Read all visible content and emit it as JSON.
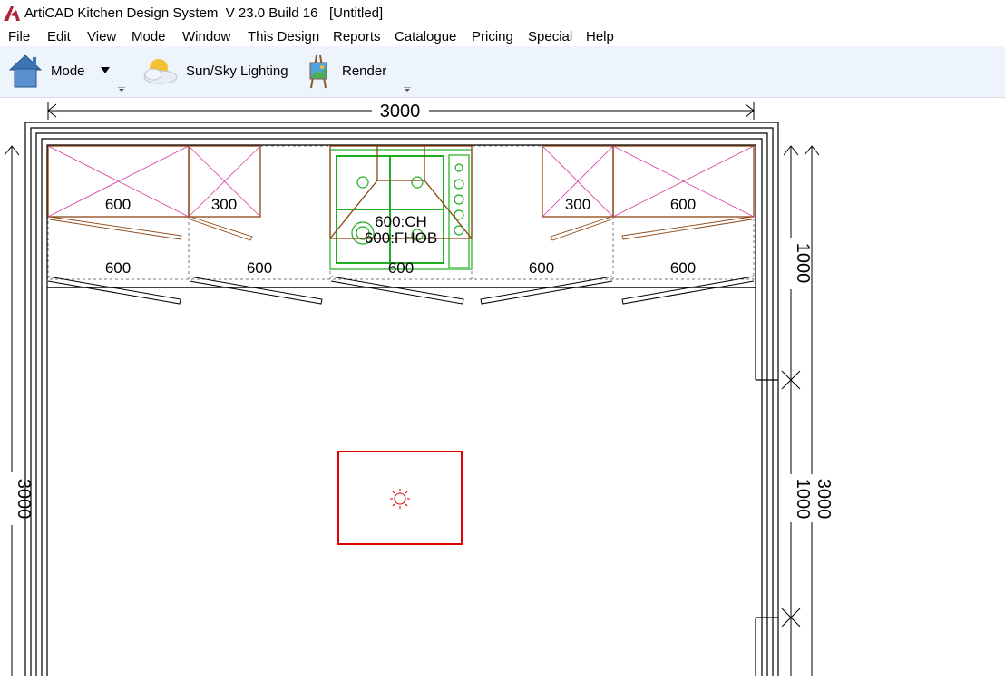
{
  "window": {
    "title": "ArtiCAD Kitchen Design System  V 23.0 Build 16   [Untitled]",
    "accent_color": "#b0223a"
  },
  "menu": {
    "items": [
      "File",
      "Edit",
      "View",
      "Mode",
      "Window",
      "This Design",
      "Reports",
      "Catalogue",
      "Pricing",
      "Special",
      "Help"
    ]
  },
  "toolbar": {
    "mode_label": "Mode",
    "mode_icon": "house-icon",
    "sun_label": "Sun/Sky Lighting",
    "sun_icon": "sun-cloud-icon",
    "render_label": "Render",
    "render_icon": "paint-easel-icon"
  },
  "plan": {
    "width_dim": "3000",
    "left_height_dim": "3000",
    "right_height_dim": "3000",
    "right_segment_top": "1000",
    "right_segment_mid": "1000",
    "wall_units": [
      "600",
      "300",
      "300",
      "600"
    ],
    "extractor_label": "600:CH",
    "hob_label": "600:FHOB",
    "base_units": [
      "600",
      "600",
      "600",
      "600",
      "600"
    ],
    "wall_color": "#000000",
    "wall_unit_color": "#8b4513",
    "unit_cross_color": "#d63aa0",
    "appliance_color": "#1fae1f",
    "selection_color": "#e00000"
  }
}
